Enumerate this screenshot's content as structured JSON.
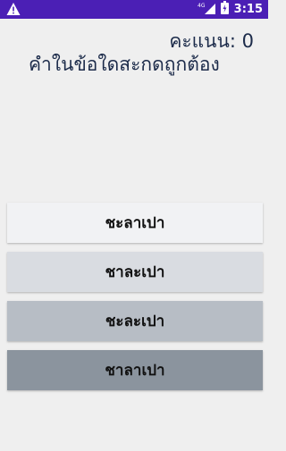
{
  "status_bar": {
    "time": "3:15",
    "network": "4G",
    "left_icon": "warning-icon",
    "icons": [
      "signal-icon",
      "battery-icon"
    ],
    "color": "#4b1fb5"
  },
  "score": {
    "text": "คะแนน: 0"
  },
  "question": {
    "text": "คำในข้อใดสะกดถูกต้อง"
  },
  "answers": [
    {
      "label": "ชะลาเปา",
      "color": "#f1f2f4"
    },
    {
      "label": "ชาละเปา",
      "color": "#d9dce1"
    },
    {
      "label": "ชะละเปา",
      "color": "#b7bdc5"
    },
    {
      "label": "ชาลาเปา",
      "color": "#8b949e"
    }
  ]
}
